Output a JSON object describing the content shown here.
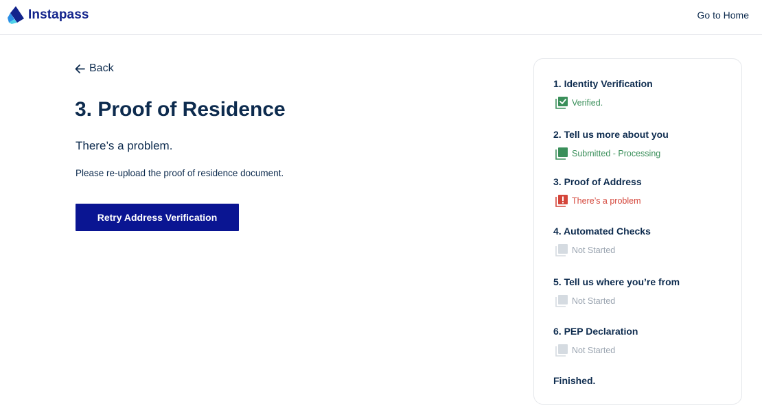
{
  "header": {
    "logo_text": "Instapass",
    "go_home_label": "Go to Home"
  },
  "main": {
    "back_label": "Back",
    "title": "3. Proof of Residence",
    "subtitle": "There’s a problem.",
    "instruction": "Please re-upload the proof of residence document.",
    "retry_button_label": "Retry Address Verification"
  },
  "steps": [
    {
      "title": "1. Identity Verification",
      "status": "Verified.",
      "state": "verified",
      "icon": "checked-box-icon"
    },
    {
      "title": "2. Tell us more about you",
      "status": "Submitted - Processing",
      "state": "processing",
      "icon": "filled-box-icon"
    },
    {
      "title": "3. Proof of Address",
      "status": "There’s a problem",
      "state": "problem",
      "icon": "exclamation-box-icon"
    },
    {
      "title": "4. Automated Checks",
      "status": "Not Started",
      "state": "not-started",
      "icon": "empty-box-icon"
    },
    {
      "title": "5. Tell us where you’re from",
      "status": "Not Started",
      "state": "not-started",
      "icon": "empty-box-icon"
    },
    {
      "title": "6. PEP Declaration",
      "status": "Not Started",
      "state": "not-started",
      "icon": "empty-box-icon"
    }
  ],
  "finished_label": "Finished.",
  "colors": {
    "brand": "#12238c",
    "primary_button": "#0a1592",
    "text": "#0d2b4e",
    "verified": "#3a8f5a",
    "problem": "#d4453a",
    "not_started": "#9aa4b0"
  }
}
